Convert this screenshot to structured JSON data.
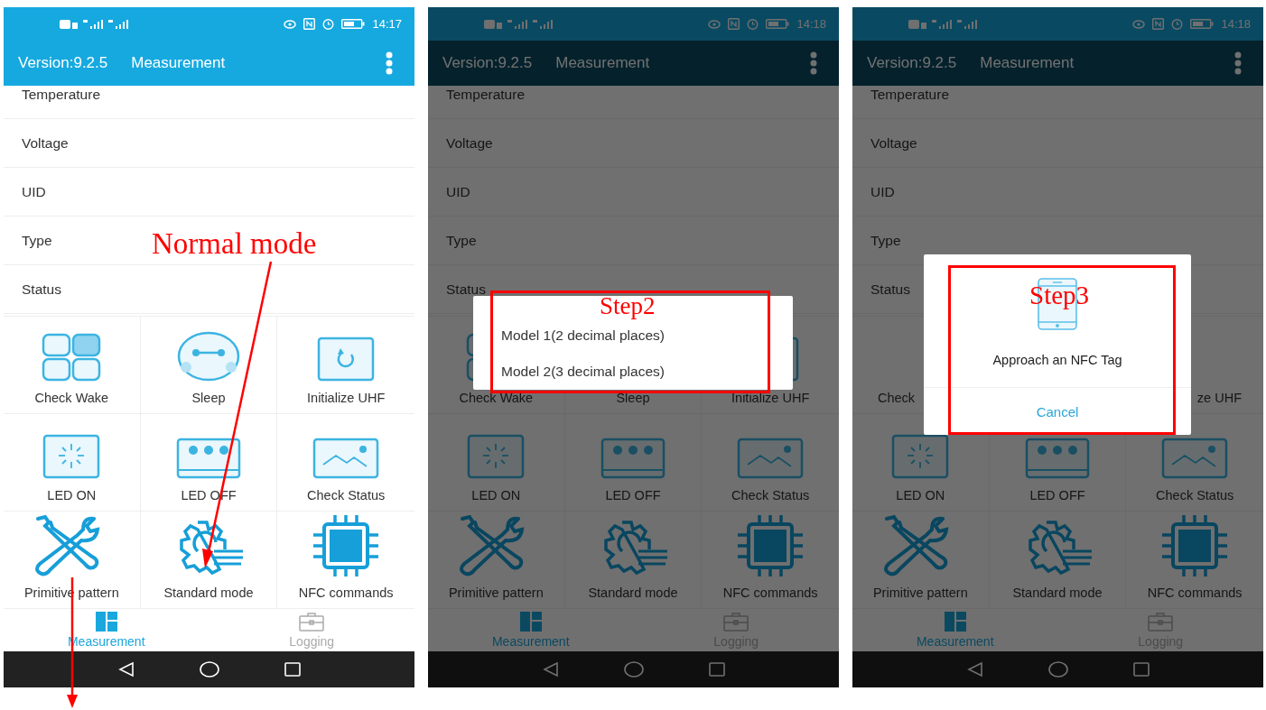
{
  "screens": [
    {
      "status_time": "14:17",
      "dimmed": false,
      "header": {
        "version": "Version:9.2.5",
        "title": "Measurement"
      },
      "list_items": [
        "Temperature",
        "Voltage",
        "UID",
        "Type",
        "Status"
      ],
      "grid_items": [
        {
          "label": "Check Wake"
        },
        {
          "label": "Sleep"
        },
        {
          "label": "Initialize UHF"
        },
        {
          "label": "LED ON"
        },
        {
          "label": "LED OFF"
        },
        {
          "label": "Check Status"
        },
        {
          "label": "Primitive pattern"
        },
        {
          "label": "Standard mode"
        },
        {
          "label": "NFC commands"
        }
      ],
      "tabs": [
        {
          "label": "Measurement",
          "selected": true
        },
        {
          "label": "Logging",
          "selected": false
        }
      ]
    },
    {
      "status_time": "14:18",
      "dimmed": true,
      "header": {
        "version": "Version:9.2.5",
        "title": "Measurement"
      },
      "list_items": [
        "Temperature",
        "Voltage",
        "UID",
        "Type",
        "Status"
      ],
      "grid_items": [
        {
          "label": "Check Wake"
        },
        {
          "label": "Sleep"
        },
        {
          "label": "Initialize UHF"
        },
        {
          "label": "LED ON"
        },
        {
          "label": "LED OFF"
        },
        {
          "label": "Check Status"
        },
        {
          "label": "Primitive pattern"
        },
        {
          "label": "Standard mode"
        },
        {
          "label": "NFC commands"
        }
      ],
      "tabs": [
        {
          "label": "Measurement",
          "selected": true
        },
        {
          "label": "Logging",
          "selected": false
        }
      ],
      "dialog": {
        "kind": "options",
        "options": [
          "Model 1(2 decimal places)",
          "Model 2(3 decimal places)"
        ],
        "annotation": "Step2"
      }
    },
    {
      "status_time": "14:18",
      "dimmed": true,
      "header": {
        "version": "Version:9.2.5",
        "title": "Measurement"
      },
      "list_items": [
        "Temperature",
        "Voltage",
        "UID",
        "Type",
        "Status"
      ],
      "grid_items": [
        {
          "label": "Check",
          "kind": "cut-end"
        },
        {
          "label": "ze UHF",
          "kind": "cut-start"
        },
        {
          "label": "LED ON",
          "kind": "full"
        },
        {
          "label": "LED OFF",
          "kind": "full"
        },
        {
          "label": "Check Status",
          "kind": "full"
        },
        {
          "label": "Primitive pattern",
          "kind": "full"
        },
        {
          "label": "Standard mode",
          "kind": "full"
        },
        {
          "label": "NFC commands",
          "kind": "full"
        }
      ],
      "tabs": [
        {
          "label": "Measurement",
          "selected": true
        },
        {
          "label": "Logging",
          "selected": false
        }
      ],
      "dialog": {
        "kind": "nfc",
        "message": "Approach an NFC Tag",
        "button": "Cancel",
        "annotation": "Step3"
      }
    }
  ],
  "annotations": [
    {
      "kind": "callout",
      "text": "Normal mode"
    }
  ]
}
